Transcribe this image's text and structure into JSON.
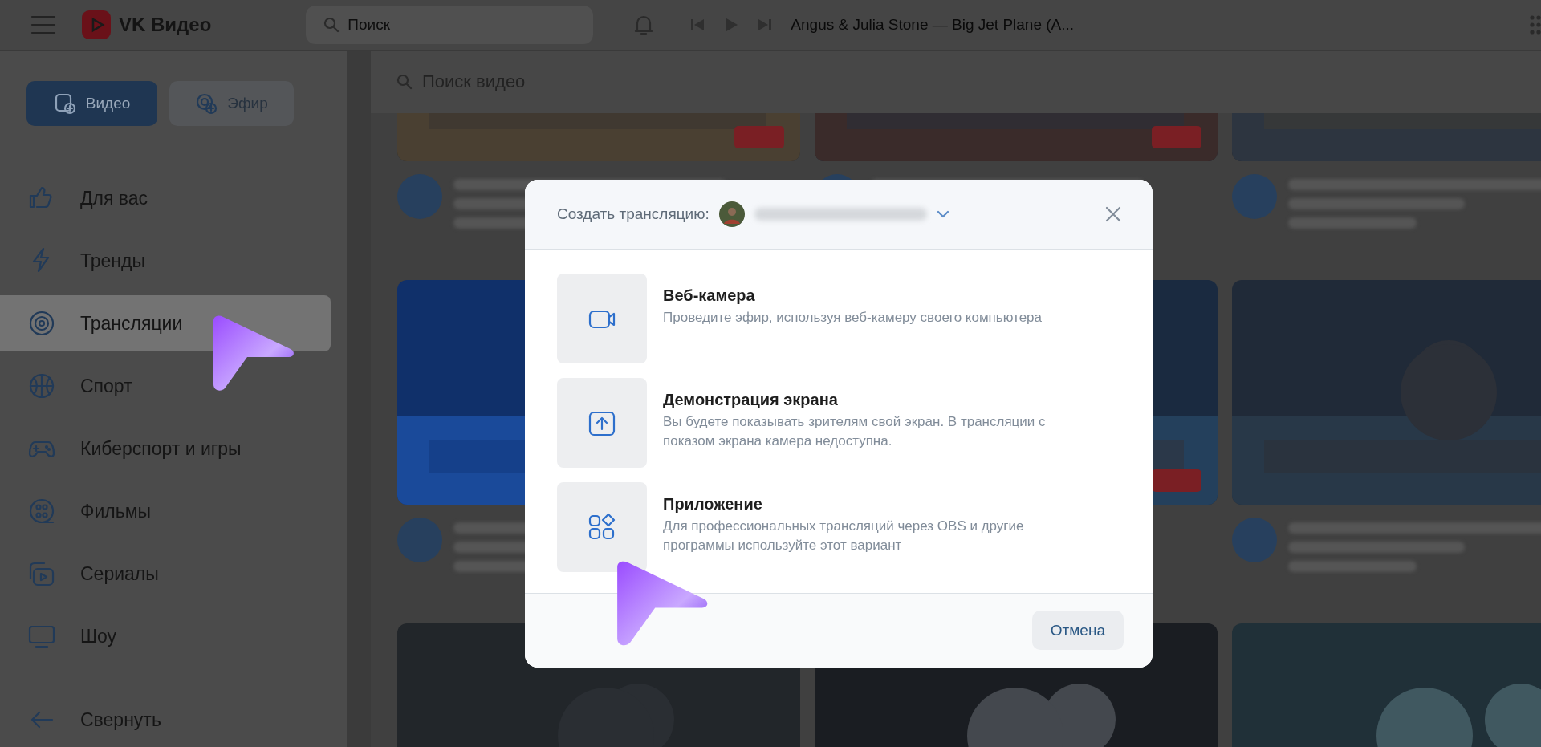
{
  "topbar": {
    "logo": "VK Видео",
    "search": {
      "placeholder": "Поиск"
    },
    "player": {
      "track": "Angus & Julia Stone — Big Jet Plane (A..."
    }
  },
  "sidebar": {
    "modes": [
      {
        "label": "Видео",
        "selected": true
      },
      {
        "label": "Эфир",
        "selected": false
      }
    ],
    "items": [
      {
        "label": "Для вас",
        "selected": false
      },
      {
        "label": "Тренды",
        "selected": false
      },
      {
        "label": "Трансляции",
        "selected": true
      },
      {
        "label": "Спорт",
        "selected": false
      },
      {
        "label": "Киберспорт и игры",
        "selected": false
      },
      {
        "label": "Фильмы",
        "selected": false
      },
      {
        "label": "Сериалы",
        "selected": false
      },
      {
        "label": "Шоу",
        "selected": false
      }
    ],
    "collapse": "Свернуть"
  },
  "content": {
    "search": {
      "placeholder": "Поиск видео"
    }
  },
  "dialog": {
    "title": "Создать трансляцию:",
    "options": [
      {
        "title": "Веб-камера",
        "description": "Проведите эфир, используя веб-камеру своего компьютера"
      },
      {
        "title": "Демонстрация экрана",
        "description": "Вы будете показывать зрителям свой экран. В трансляции с показом экрана камера недоступна."
      },
      {
        "title": "Приложение",
        "description": "Для профессиональных трансляций через OBS и другие программы используйте этот вариант"
      }
    ],
    "cancel": "Отмена"
  }
}
